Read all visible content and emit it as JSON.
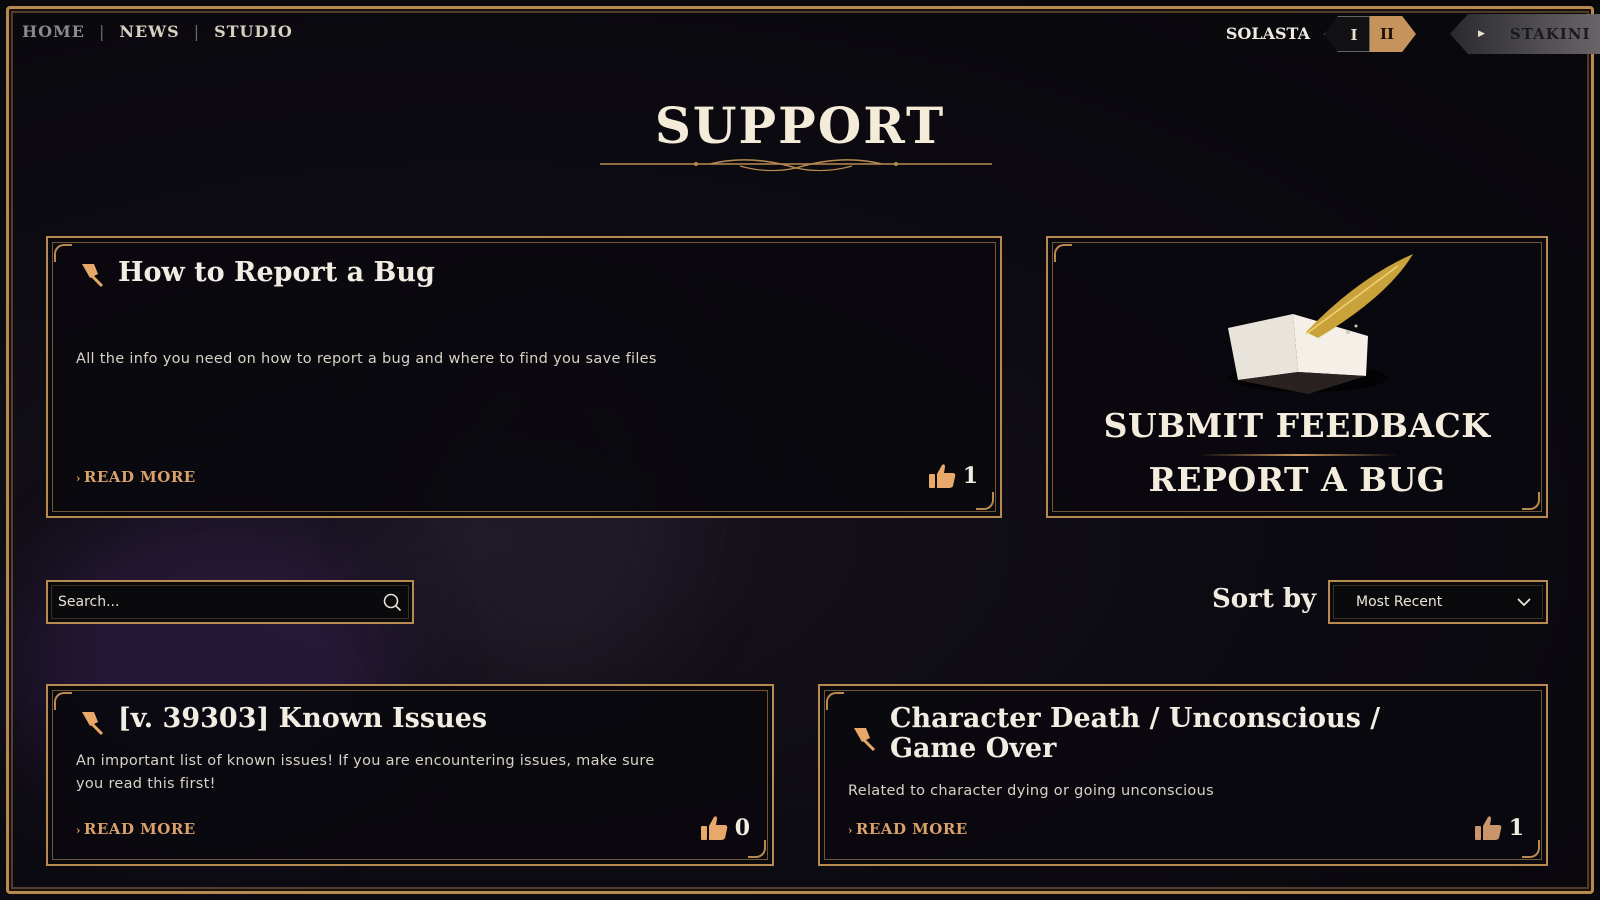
{
  "topnav": {
    "links": [
      "HOME",
      "NEWS",
      "STUDIO"
    ],
    "separator": "|"
  },
  "gamenav": {
    "label": "SOLASTA",
    "roman_one": "I",
    "roman_two": "II",
    "extra_label": "STAKINI"
  },
  "page": {
    "title": "SUPPORT"
  },
  "featured": {
    "title": "How to Report a Bug",
    "description": "All the info you need on how to report a bug and where to find you save files",
    "read_more": "READ MORE",
    "likes": "1"
  },
  "feedback": {
    "line1": "SUBMIT FEEDBACK",
    "line2": "REPORT A BUG"
  },
  "search": {
    "placeholder": "Search..."
  },
  "sort": {
    "label": "Sort by",
    "selected": "Most Recent"
  },
  "articles": [
    {
      "title": "[v. 39303] Known Issues",
      "description": "An important list of known issues! If you are encountering issues, make sure you read this first!",
      "read_more": "READ MORE",
      "likes": "0"
    },
    {
      "title": "Character Death / Unconscious / Game Over",
      "description": "Related to character dying or going unconscious",
      "read_more": "READ MORE",
      "likes": "1"
    }
  ],
  "colors": {
    "accent_gold": "#b88a50",
    "link_orange": "#d8a26a",
    "background": "#0d0b12"
  }
}
